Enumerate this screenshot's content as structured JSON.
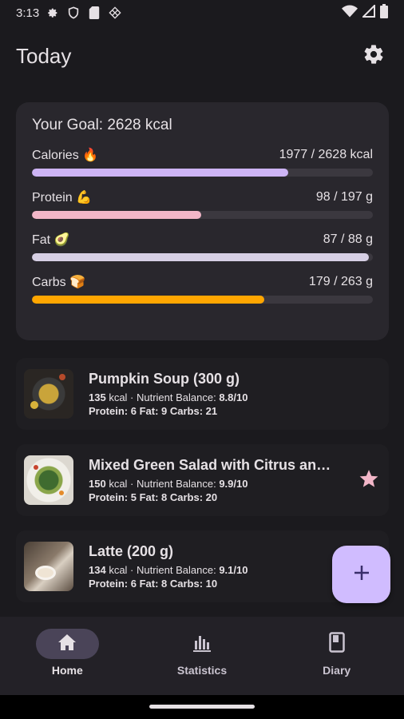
{
  "status_bar": {
    "time": "3:13",
    "icons": [
      "settings-gear-icon",
      "shield-icon",
      "sim-card-icon",
      "grid-icon"
    ],
    "right_icons": [
      "wifi-icon",
      "cellular-signal-icon",
      "battery-icon"
    ]
  },
  "header": {
    "title": "Today",
    "settings_icon": "gear-icon"
  },
  "goal": {
    "title": "Your Goal: 2628 kcal",
    "macros": [
      {
        "label": "Calories 🔥",
        "value": "1977 / 2628 kcal",
        "progress": 0.752,
        "color": "#cdb4f5"
      },
      {
        "label": "Protein 💪",
        "value": "98 / 197 g",
        "progress": 0.497,
        "color": "#f2b6c8"
      },
      {
        "label": "Fat 🥑",
        "value": "87 / 88 g",
        "progress": 0.989,
        "color": "#d6cfe4"
      },
      {
        "label": "Carbs 🍞",
        "value": "179 / 263 g",
        "progress": 0.681,
        "color": "#ffa600"
      }
    ]
  },
  "meals": [
    {
      "name": "Pumpkin Soup (300 g)",
      "kcal": "135",
      "kcal_unit": " kcal · Nutrient Balance: ",
      "balance": "8.8/10",
      "macros_line": "Protein: 6 Fat: 9 Carbs: 21",
      "favorite": false
    },
    {
      "name": "Mixed Green Salad with Citrus and Nuts",
      "kcal": "150",
      "kcal_unit": " kcal · Nutrient Balance: ",
      "balance": "9.9/10",
      "macros_line": "Protein: 5 Fat: 8 Carbs: 20",
      "favorite": true
    },
    {
      "name": "Latte (200 g)",
      "kcal": "134",
      "kcal_unit": " kcal · Nutrient Balance: ",
      "balance": "9.1/10",
      "macros_line": "Protein: 6 Fat: 8 Carbs: 10",
      "favorite": false
    }
  ],
  "fab": {
    "icon": "plus-icon"
  },
  "nav": [
    {
      "label": "Home",
      "icon": "home-icon",
      "active": true
    },
    {
      "label": "Statistics",
      "icon": "bar-chart-icon",
      "active": false
    },
    {
      "label": "Diary",
      "icon": "book-icon",
      "active": false
    }
  ],
  "colors": {
    "background": "#1b1a1e",
    "card": "#29272d",
    "accent": "#d0bcff",
    "star": "#f2b6c8"
  }
}
